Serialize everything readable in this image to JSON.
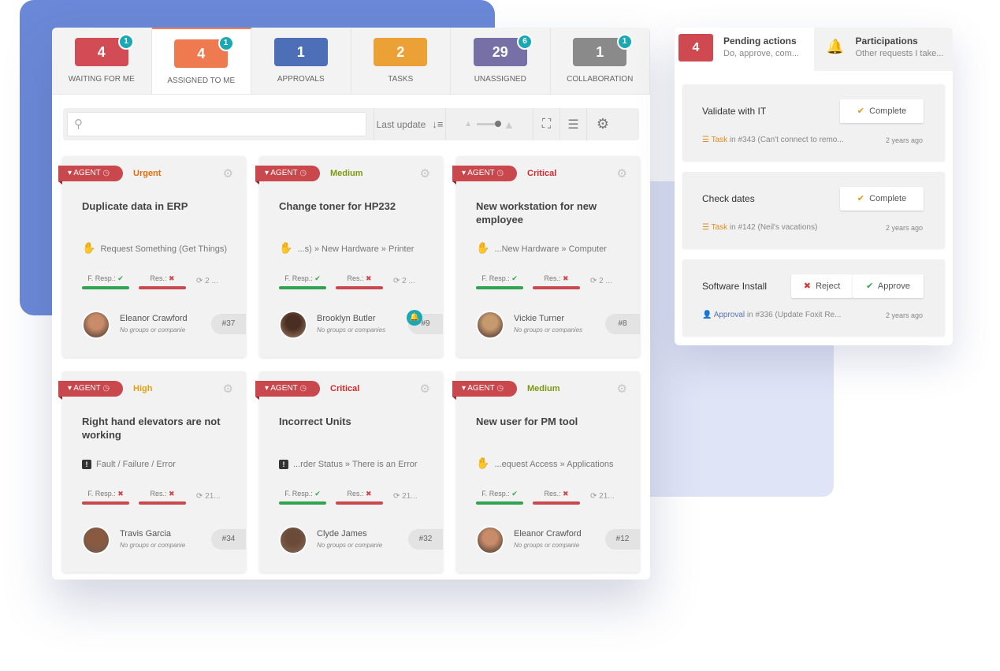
{
  "tabs": [
    {
      "label": "WAITING FOR ME",
      "count": "4",
      "badge": "1",
      "color": "#d14c55",
      "active": false
    },
    {
      "label": "ASSIGNED TO ME",
      "count": "4",
      "badge": "1",
      "color": "#f07a50",
      "active": true
    },
    {
      "label": "APPROVALS",
      "count": "1",
      "badge": "",
      "color": "#4d6fb8",
      "active": false
    },
    {
      "label": "TASKS",
      "count": "2",
      "badge": "",
      "color": "#eba136",
      "active": false
    },
    {
      "label": "UNASSIGNED",
      "count": "29",
      "badge": "6",
      "color": "#7670a6",
      "active": false
    },
    {
      "label": "COLLABORATION",
      "count": "1",
      "badge": "1",
      "color": "#8a8a8a",
      "active": false
    }
  ],
  "toolbar": {
    "search_placeholder": "",
    "sort_label": "Last update"
  },
  "cards": [
    {
      "agent": "AGENT",
      "priority": "Urgent",
      "priority_color": "#e06d10",
      "title": "Duplicate data in ERP",
      "category": "Request Something (Get Things)",
      "cat_icon": "hand-box",
      "first_resp": "F. Resp.:",
      "resolution": "Res.:",
      "updated": "2 ...",
      "user": "Eleanor Crawford",
      "groups": "No groups or companie",
      "number": "#37",
      "bell": false,
      "avatar_color": "#c98c6a"
    },
    {
      "agent": "AGENT",
      "priority": "Medium",
      "priority_color": "#7a9a12",
      "title": "Change toner for HP232",
      "category": "...s)  »  New Hardware  »  Printer",
      "cat_icon": "hand-box",
      "first_resp": "F. Resp.:",
      "resolution": "Res.:",
      "updated": "2 ...",
      "user": "Brooklyn Butler",
      "groups": "No groups or companies",
      "number": "#9",
      "bell": true,
      "avatar_color": "#4a2e22"
    },
    {
      "agent": "AGENT",
      "priority": "Critical",
      "priority_color": "#d42a2a",
      "title": "New workstation for new employee",
      "category": "...New Hardware  »  Computer",
      "cat_icon": "hand-box",
      "first_resp": "F. Resp.:",
      "resolution": "Res.:",
      "updated": "2 ...",
      "user": "Vickie Turner",
      "groups": "No groups or companies",
      "number": "#8",
      "bell": false,
      "avatar_color": "#c79a6e"
    },
    {
      "agent": "AGENT",
      "priority": "High",
      "priority_color": "#e0a012",
      "title": "Right hand elevators are not working",
      "category": "Fault / Failure / Error",
      "cat_icon": "exclamation",
      "first_resp": "F. Resp.:",
      "resolution": "Res.:",
      "updated": "21...",
      "user": "Travis Garcia",
      "groups": "No groups or companie",
      "number": "#34",
      "bell": false,
      "avatar_color": "#8a5a40"
    },
    {
      "agent": "AGENT",
      "priority": "Critical",
      "priority_color": "#d42a2a",
      "title": "Incorrect Units",
      "category": "...rder Status  »  There is an Error",
      "cat_icon": "exclamation",
      "first_resp": "F. Resp.:",
      "resolution": "Res.:",
      "updated": "21...",
      "user": "Clyde James",
      "groups": "No groups or companie",
      "number": "#32",
      "bell": false,
      "avatar_color": "#6a4a38"
    },
    {
      "agent": "AGENT",
      "priority": "Medium",
      "priority_color": "#7a9a12",
      "title": "New user for PM tool",
      "category": "...equest Access  »  Applications",
      "cat_icon": "hand-box",
      "first_resp": "F. Resp.:",
      "resolution": "Res.:",
      "updated": "21...",
      "user": "Eleanor Crawford",
      "groups": "No groups or companie",
      "number": "#12",
      "bell": false,
      "avatar_color": "#c98c6a"
    }
  ],
  "card_sla": [
    {
      "first_ok": true,
      "res_ok": false
    },
    {
      "first_ok": true,
      "res_ok": false
    },
    {
      "first_ok": true,
      "res_ok": false
    },
    {
      "first_ok": false,
      "res_ok": false
    },
    {
      "first_ok": true,
      "res_ok": false
    },
    {
      "first_ok": true,
      "res_ok": false
    }
  ],
  "side": {
    "pending_count": "4",
    "pending_title": "Pending actions",
    "pending_sub": "Do, approve, com...",
    "part_title": "Participations",
    "part_sub": "Other requests I take...",
    "actions": [
      {
        "title": "Validate with IT",
        "buttons": [
          "Complete"
        ],
        "type": "Task",
        "type_color": "#e08a1e",
        "ref": " in #343 (Can't connect to remo...",
        "ago": "2 years ago"
      },
      {
        "title": "Check dates",
        "buttons": [
          "Complete"
        ],
        "type": "Task",
        "type_color": "#e08a1e",
        "ref": " in #142 (Neil's vacations)",
        "ago": "2 years ago"
      },
      {
        "title": "Software Install",
        "buttons": [
          "Reject",
          "Approve"
        ],
        "type": "Approval",
        "type_color": "#5a73b8",
        "ref": " in #336 (Update Foxit Re...",
        "ago": "2 years ago"
      }
    ]
  }
}
